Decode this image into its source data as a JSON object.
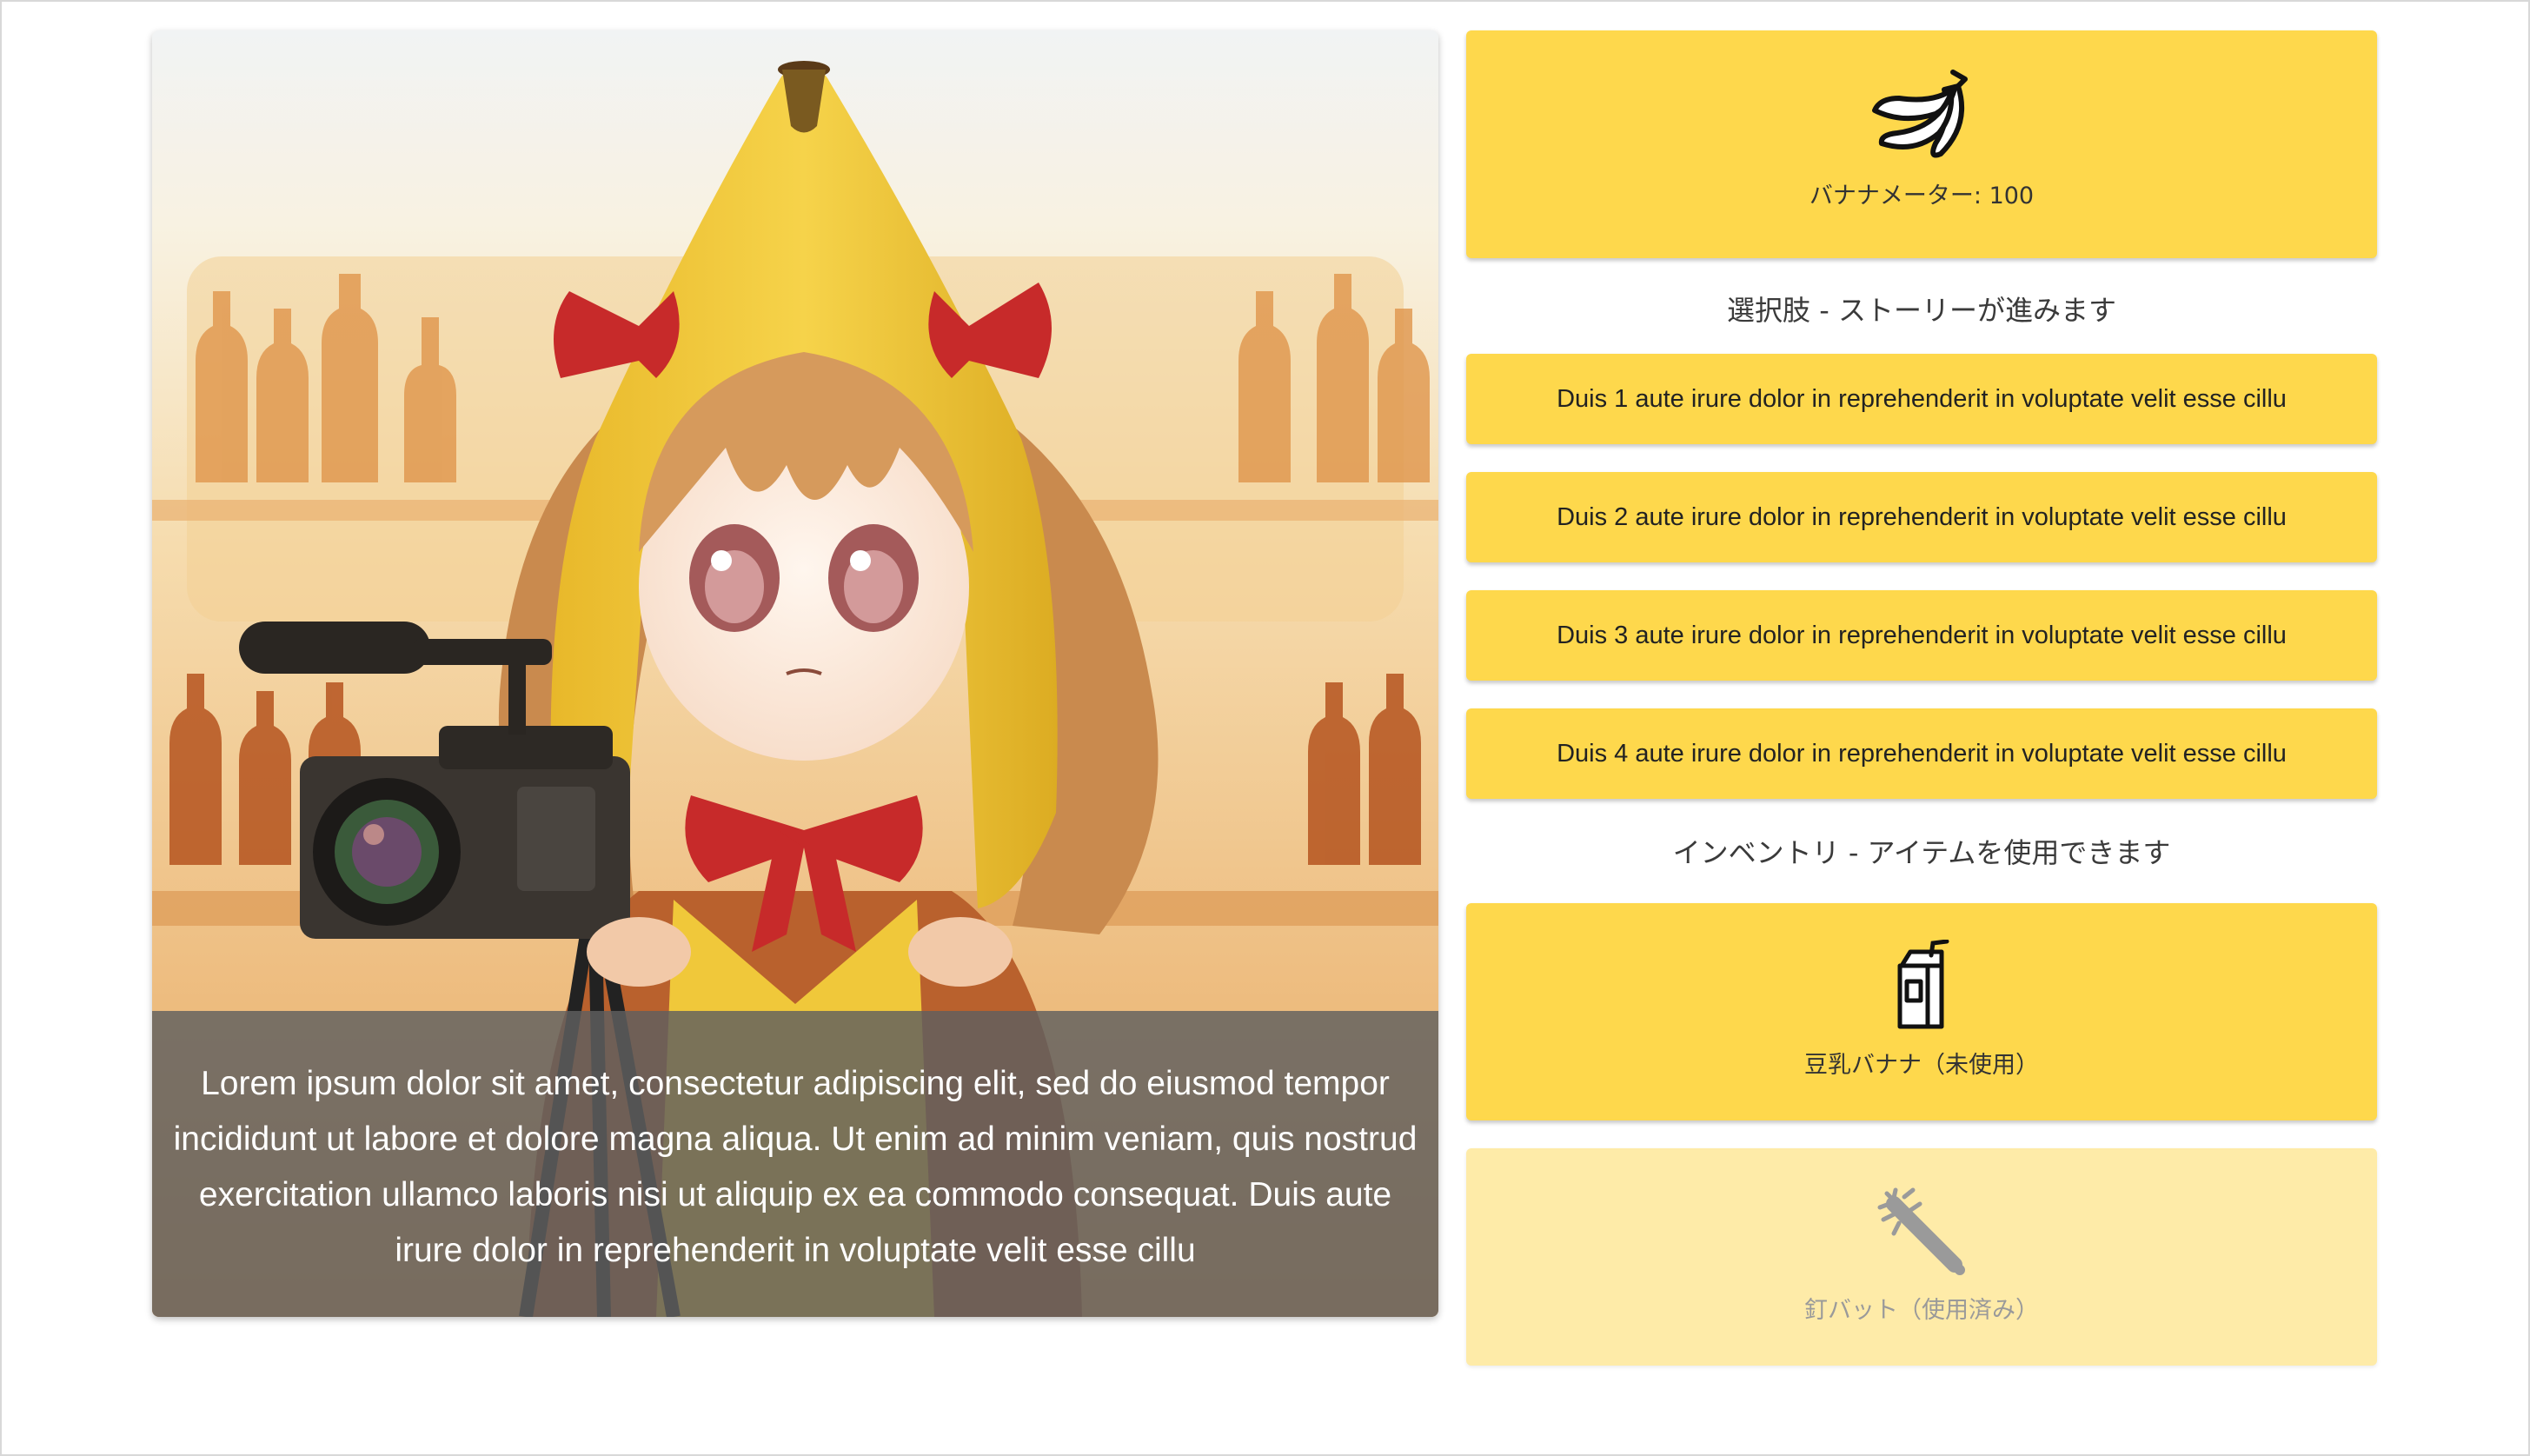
{
  "scene": {
    "narration": "Lorem ipsum dolor sit amet, consectetur adipiscing elit, sed do eiusmod tempor incididunt ut labore et dolore magna aliqua. Ut enim ad minim veniam, quis nostrud exercitation ullamco laboris nisi ut aliquip ex ea commodo consequat. Duis aute irure dolor in reprehenderit in voluptate velit esse cillu",
    "image_icon": "banana-girl-with-camera-illustration"
  },
  "meter": {
    "icon": "banana-icon",
    "label": "バナナメーター: 100"
  },
  "choices": {
    "heading": "選択肢 - ストーリーが進みます",
    "items": [
      {
        "label": "Duis 1 aute irure dolor in reprehenderit in voluptate velit esse cillu"
      },
      {
        "label": "Duis 2 aute irure dolor in reprehenderit in voluptate velit esse cillu"
      },
      {
        "label": "Duis 3 aute irure dolor in reprehenderit in voluptate velit esse cillu"
      },
      {
        "label": "Duis 4 aute irure dolor in reprehenderit in voluptate velit esse cillu"
      }
    ]
  },
  "inventory": {
    "heading": "インベントリ - アイテムを使用できます",
    "items": [
      {
        "icon": "soy-milk-carton-icon",
        "label": "豆乳バナナ（未使用）",
        "used": false
      },
      {
        "icon": "nail-bat-icon",
        "label": "釘バット（使用済み）",
        "used": true
      }
    ]
  },
  "colors": {
    "card": "#fed84c",
    "card_used": "#feeba8",
    "overlay": "#5f5f5f"
  }
}
